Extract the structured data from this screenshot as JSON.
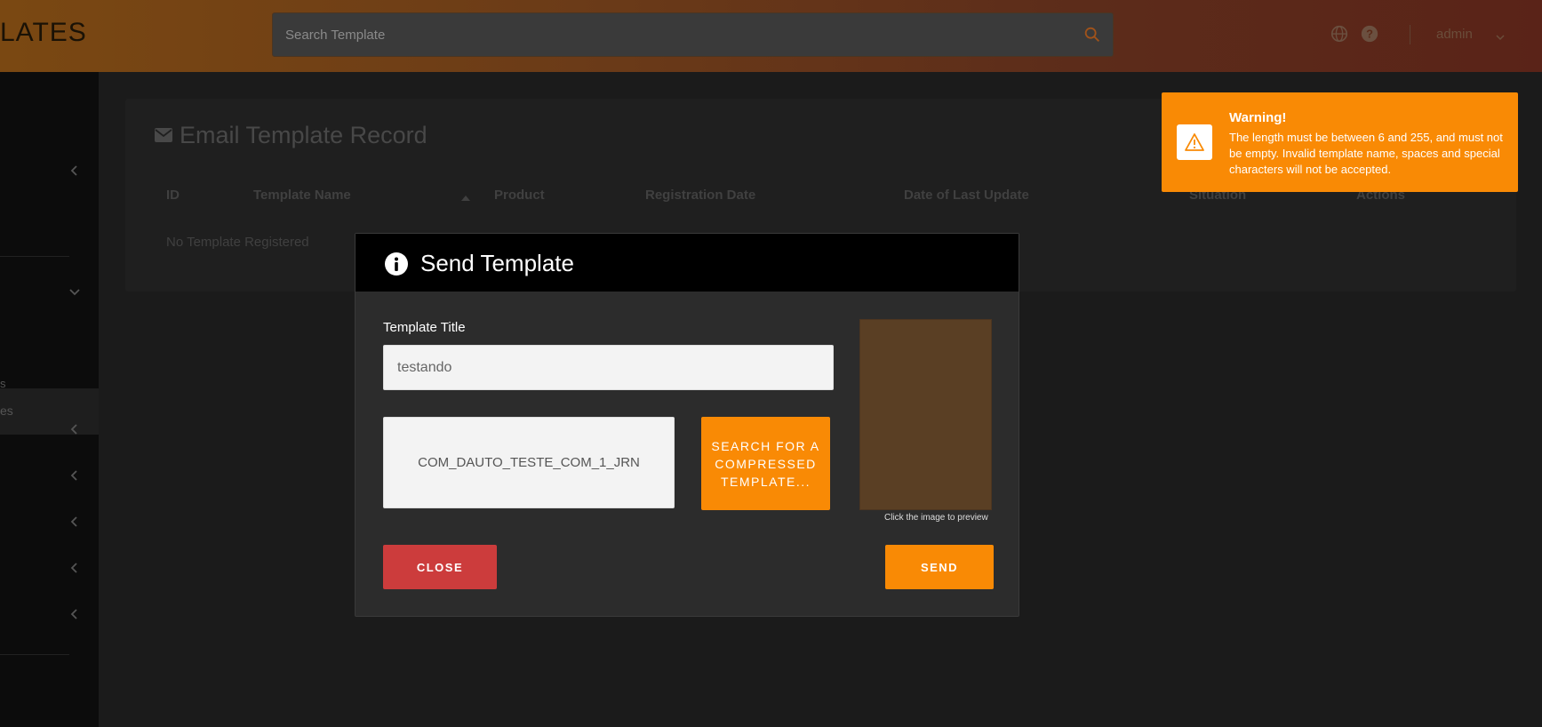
{
  "header": {
    "logo_text": "LATES",
    "search_placeholder": "Search Template",
    "user_name": "admin"
  },
  "sidebar": {
    "item_active_fragment": "es",
    "item_fragment": "s"
  },
  "panel": {
    "title": "Email Template Record",
    "columns": [
      "ID",
      "Template Name",
      "Product",
      "Registration Date",
      "Date of Last Update",
      "Situation",
      "Actions"
    ],
    "empty_text": "No Template Registered"
  },
  "modal": {
    "title": "Send Template",
    "field_label": "Template Title",
    "title_value": "testando",
    "file_name": "COM_DAUTO_TESTE_COM_1_JRN",
    "search_button": "SEARCH FOR A COMPRESSED TEMPLATE...",
    "preview_caption": "Click the image to preview",
    "close_label": "CLOSE",
    "send_label": "SEND"
  },
  "toast": {
    "title": "Warning!",
    "message": "The length must be between 6 and 255, and must not be empty. Invalid template name, spaces and special characters will not be accepted."
  },
  "colors": {
    "accent": "#f98a05",
    "danger": "#cc3c3c",
    "modal_header": "#000000",
    "modal_body": "#2c2c2c"
  }
}
